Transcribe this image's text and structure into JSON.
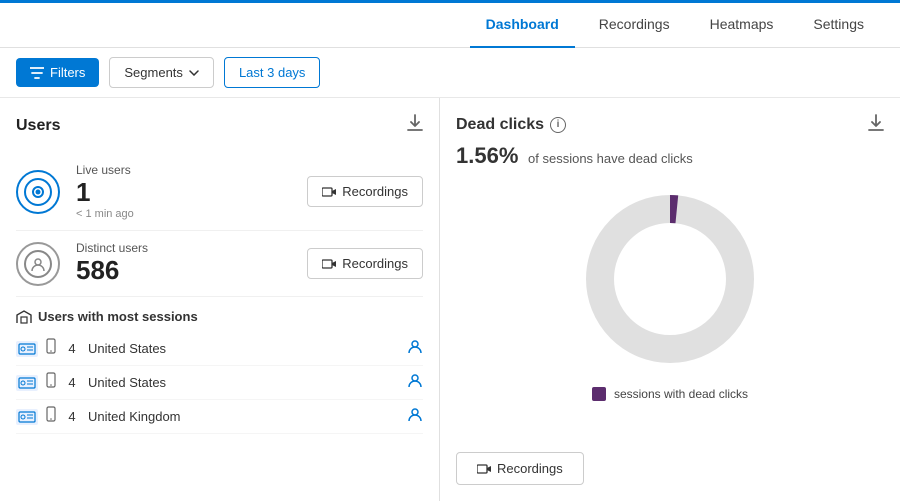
{
  "nav": {
    "items": [
      {
        "label": "Dashboard",
        "active": true
      },
      {
        "label": "Recordings",
        "active": false
      },
      {
        "label": "Heatmaps",
        "active": false
      },
      {
        "label": "Settings",
        "active": false
      }
    ]
  },
  "toolbar": {
    "filters_label": "Filters",
    "segments_label": "Segments",
    "date_label": "Last 3 days"
  },
  "users_panel": {
    "title": "Users",
    "live_users_label": "Live users",
    "live_count": "1",
    "live_sub": "< 1 min ago",
    "distinct_users_label": "Distinct users",
    "distinct_count": "586",
    "recordings_btn": "Recordings",
    "sessions_header": "Users with most sessions",
    "sessions": [
      {
        "count": "4",
        "country": "United States"
      },
      {
        "count": "4",
        "country": "United States"
      },
      {
        "count": "4",
        "country": "United Kingdom"
      }
    ]
  },
  "dead_clicks_panel": {
    "title": "Dead clicks",
    "percentage": "1.56%",
    "description": "of sessions have dead clicks",
    "legend_label": "sessions with dead clicks",
    "recordings_btn": "Recordings",
    "donut": {
      "total_angle": 360,
      "filled_pct": 1.56,
      "color_filled": "#5c2d6e",
      "color_bg": "#e0e0e0"
    }
  }
}
